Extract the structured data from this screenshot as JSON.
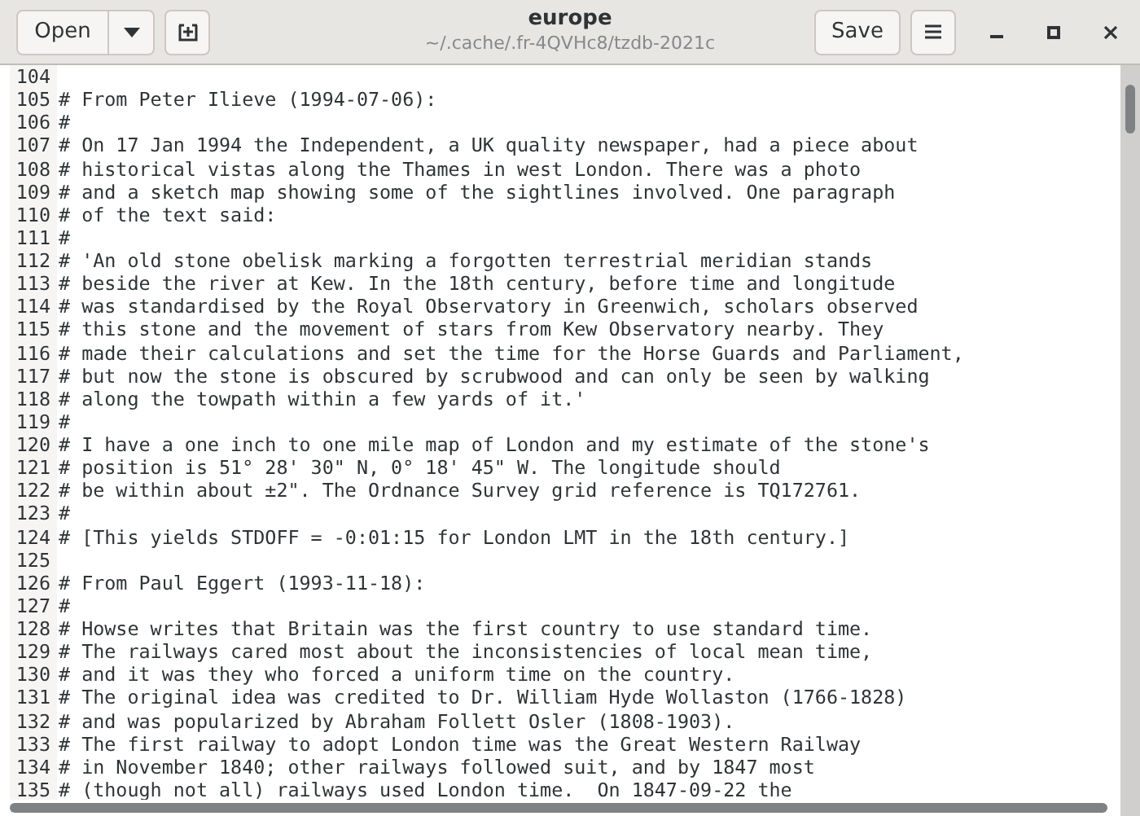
{
  "header": {
    "title": "europe",
    "subtitle": "~/.cache/.fr-4QVHc8/tzdb-2021c",
    "open_button": "Open",
    "save_button": "Save"
  },
  "editor": {
    "lines": [
      {
        "number": "104"
      },
      {
        "number": "105",
        "text": "# From Peter Ilieve (1994-07-06):"
      },
      {
        "number": "106",
        "text": "#"
      },
      {
        "number": "107",
        "text": "# On 17 Jan 1994 the Independent, a UK quality newspaper, had a piece about"
      },
      {
        "number": "108",
        "text": "# historical vistas along the Thames in west London. There was a photo"
      },
      {
        "number": "109",
        "text": "# and a sketch map showing some of the sightlines involved. One paragraph"
      },
      {
        "number": "110",
        "text": "# of the text said:"
      },
      {
        "number": "111",
        "text": "#"
      },
      {
        "number": "112",
        "text": "# 'An old stone obelisk marking a forgotten terrestrial meridian stands"
      },
      {
        "number": "113",
        "text": "# beside the river at Kew. In the 18th century, before time and longitude"
      },
      {
        "number": "114",
        "text": "# was standardised by the Royal Observatory in Greenwich, scholars observed"
      },
      {
        "number": "115",
        "text": "# this stone and the movement of stars from Kew Observatory nearby. They"
      },
      {
        "number": "116",
        "text": "# made their calculations and set the time for the Horse Guards and Parliament,"
      },
      {
        "number": "117",
        "text": "# but now the stone is obscured by scrubwood and can only be seen by walking"
      },
      {
        "number": "118",
        "text": "# along the towpath within a few yards of it.'"
      },
      {
        "number": "119",
        "text": "#"
      },
      {
        "number": "120",
        "text": "# I have a one inch to one mile map of London and my estimate of the stone's"
      },
      {
        "number": "121",
        "text": "# position is 51° 28' 30\" N, 0° 18' 45\" W. The longitude should"
      },
      {
        "number": "122",
        "text": "# be within about ±2\". The Ordnance Survey grid reference is TQ172761."
      },
      {
        "number": "123",
        "text": "#"
      },
      {
        "number": "124",
        "text": "# [This yields STDOFF = -0:01:15 for London LMT in the 18th century.]"
      },
      {
        "number": "125"
      },
      {
        "number": "126",
        "text": "# From Paul Eggert (1993-11-18):"
      },
      {
        "number": "127",
        "text": "#"
      },
      {
        "number": "128",
        "text": "# Howse writes that Britain was the first country to use standard time."
      },
      {
        "number": "129",
        "text": "# The railways cared most about the inconsistencies of local mean time,"
      },
      {
        "number": "130",
        "text": "# and it was they who forced a uniform time on the country."
      },
      {
        "number": "131",
        "text": "# The original idea was credited to Dr. William Hyde Wollaston (1766-1828)"
      },
      {
        "number": "132",
        "text": "# and was popularized by Abraham Follett Osler (1808-1903)."
      },
      {
        "number": "133",
        "text": "# The first railway to adopt London time was the Great Western Railway"
      },
      {
        "number": "134",
        "text": "# in November 1840; other railways followed suit, and by 1847 most"
      },
      {
        "number": "135",
        "text": "# (though not all) railways used London time.  On 1847-09-22 the"
      }
    ]
  }
}
